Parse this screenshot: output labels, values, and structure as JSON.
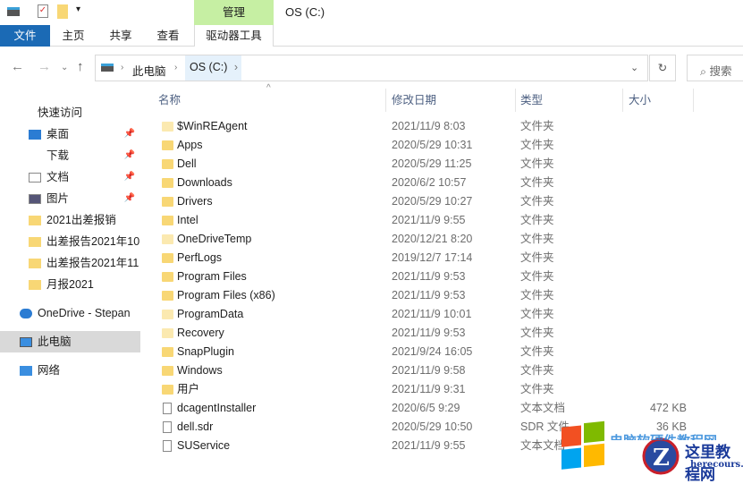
{
  "window": {
    "title": "OS (C:)",
    "context_tab": "管理"
  },
  "ribbon": {
    "tabs": [
      "文件",
      "主页",
      "共享",
      "查看",
      "驱动器工具"
    ]
  },
  "address": {
    "crumbs": [
      "此电脑",
      "OS (C:)"
    ],
    "search_placeholder": "搜索"
  },
  "sidebar": {
    "items": [
      {
        "label": "快速访问",
        "icon": "star-icon"
      },
      {
        "label": "桌面",
        "icon": "desktop-icon",
        "pinned": true
      },
      {
        "label": "下载",
        "icon": "download-icon",
        "pinned": true
      },
      {
        "label": "文档",
        "icon": "document-icon",
        "pinned": true
      },
      {
        "label": "图片",
        "icon": "picture-icon",
        "pinned": true
      },
      {
        "label": "2021出差报销",
        "icon": "folder-icon"
      },
      {
        "label": "出差报告2021年10",
        "icon": "folder-icon"
      },
      {
        "label": "出差报告2021年11",
        "icon": "folder-icon"
      },
      {
        "label": "月报2021",
        "icon": "folder-icon"
      },
      {
        "label": "OneDrive - Stepan",
        "icon": "cloud-icon"
      },
      {
        "label": "此电脑",
        "icon": "computer-icon",
        "selected": true
      },
      {
        "label": "网络",
        "icon": "network-icon"
      }
    ]
  },
  "columns": {
    "name": "名称",
    "date": "修改日期",
    "type": "类型",
    "size": "大小"
  },
  "files": [
    {
      "name": "$WinREAgent",
      "date": "2021/11/9 8:03",
      "type": "文件夹",
      "size": "",
      "kind": "light"
    },
    {
      "name": "Apps",
      "date": "2020/5/29 10:31",
      "type": "文件夹",
      "size": "",
      "kind": "folder"
    },
    {
      "name": "Dell",
      "date": "2020/5/29 11:25",
      "type": "文件夹",
      "size": "",
      "kind": "folder"
    },
    {
      "name": "Downloads",
      "date": "2020/6/2 10:57",
      "type": "文件夹",
      "size": "",
      "kind": "folder"
    },
    {
      "name": "Drivers",
      "date": "2020/5/29 10:27",
      "type": "文件夹",
      "size": "",
      "kind": "folder"
    },
    {
      "name": "Intel",
      "date": "2021/11/9 9:55",
      "type": "文件夹",
      "size": "",
      "kind": "folder"
    },
    {
      "name": "OneDriveTemp",
      "date": "2020/12/21 8:20",
      "type": "文件夹",
      "size": "",
      "kind": "light"
    },
    {
      "name": "PerfLogs",
      "date": "2019/12/7 17:14",
      "type": "文件夹",
      "size": "",
      "kind": "folder"
    },
    {
      "name": "Program Files",
      "date": "2021/11/9 9:53",
      "type": "文件夹",
      "size": "",
      "kind": "folder"
    },
    {
      "name": "Program Files (x86)",
      "date": "2021/11/9 9:53",
      "type": "文件夹",
      "size": "",
      "kind": "folder"
    },
    {
      "name": "ProgramData",
      "date": "2021/11/9 10:01",
      "type": "文件夹",
      "size": "",
      "kind": "light"
    },
    {
      "name": "Recovery",
      "date": "2021/11/9 9:53",
      "type": "文件夹",
      "size": "",
      "kind": "light"
    },
    {
      "name": "SnapPlugin",
      "date": "2021/9/24 16:05",
      "type": "文件夹",
      "size": "",
      "kind": "folder"
    },
    {
      "name": "Windows",
      "date": "2021/11/9 9:58",
      "type": "文件夹",
      "size": "",
      "kind": "folder"
    },
    {
      "name": "用户",
      "date": "2021/11/9 9:31",
      "type": "文件夹",
      "size": "",
      "kind": "folder"
    },
    {
      "name": "dcagentInstaller",
      "date": "2020/6/5 9:29",
      "type": "文本文档",
      "size": "472 KB",
      "kind": "doc"
    },
    {
      "name": "dell.sdr",
      "date": "2020/5/29 10:50",
      "type": "SDR 文件",
      "size": "36 KB",
      "kind": "doc"
    },
    {
      "name": "SUService",
      "date": "2021/11/9 9:55",
      "type": "文本文档",
      "size": "",
      "kind": "doc"
    }
  ],
  "watermark": {
    "title": "这里教程网",
    "url": "herecours.com",
    "banner": "电脑软硬件教程网"
  }
}
